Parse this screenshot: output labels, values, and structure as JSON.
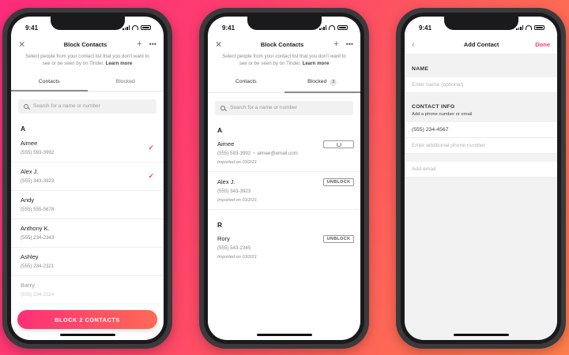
{
  "status_time": "9:41",
  "screen1": {
    "title": "Block Contacts",
    "close_icon": "close-icon",
    "description": "Select people from your contact list that you don't want to see or be seen by on Tinder.",
    "learn_more": "Learn more",
    "tabs": [
      {
        "label": "Contacts"
      },
      {
        "label": "Blocked"
      }
    ],
    "search_placeholder": "Search for a name or number",
    "section": "A",
    "contacts": [
      {
        "name": "Aimee",
        "phone": "(555) 593-3992",
        "checked": true
      },
      {
        "name": "Alex J.",
        "phone": "(555) 343-3923",
        "checked": true
      },
      {
        "name": "Andy",
        "phone": "(555) 555-5678",
        "checked": false
      },
      {
        "name": "Anthony K.",
        "phone": "(555) 234-2343",
        "checked": false
      },
      {
        "name": "Ashley",
        "phone": "(555) 234-2321",
        "checked": false
      },
      {
        "name": "Barry",
        "phone": "(555) 234-2324",
        "checked": false
      }
    ],
    "block_button": "BLOCK 2 CONTACTS"
  },
  "screen2": {
    "title": "Block Contacts",
    "description": "Select people from your contact list that you don't want to see or be seen by on Tinder.",
    "learn_more": "Learn more",
    "tabs": [
      {
        "label": "Contacts"
      },
      {
        "label": "Blocked",
        "badge": "3"
      }
    ],
    "search_placeholder": "Search for a name or number",
    "sections": [
      {
        "letter": "A",
        "items": [
          {
            "name": "Aimee",
            "phone": "(555) 593-3992",
            "email": "aimee@email.com",
            "imported": "Imported on 03/2/21",
            "state": "loading"
          },
          {
            "name": "Alex J.",
            "phone": "(555) 343-3923",
            "imported": "Imported on 03/2/21",
            "state": "UNBLOCK"
          }
        ]
      },
      {
        "letter": "R",
        "items": [
          {
            "name": "Rory",
            "phone": "(555) 543-2345",
            "imported": "Imported on 03/2/21",
            "state": "UNBLOCK"
          }
        ]
      }
    ]
  },
  "screen3": {
    "title": "Add Contact",
    "done": "Done",
    "name_label": "NAME",
    "name_placeholder": "Enter name (optional)",
    "contact_label": "CONTACT INFO",
    "contact_sub": "Add a phone number or email",
    "phone_value": "(555) 234-4567",
    "phone_placeholder": "Enter additional phone number",
    "email_placeholder": "Add email"
  },
  "colors": {
    "accent": "#fd3a6e",
    "gradient_start": "#fd2c7d",
    "gradient_end": "#ff7d4b"
  }
}
